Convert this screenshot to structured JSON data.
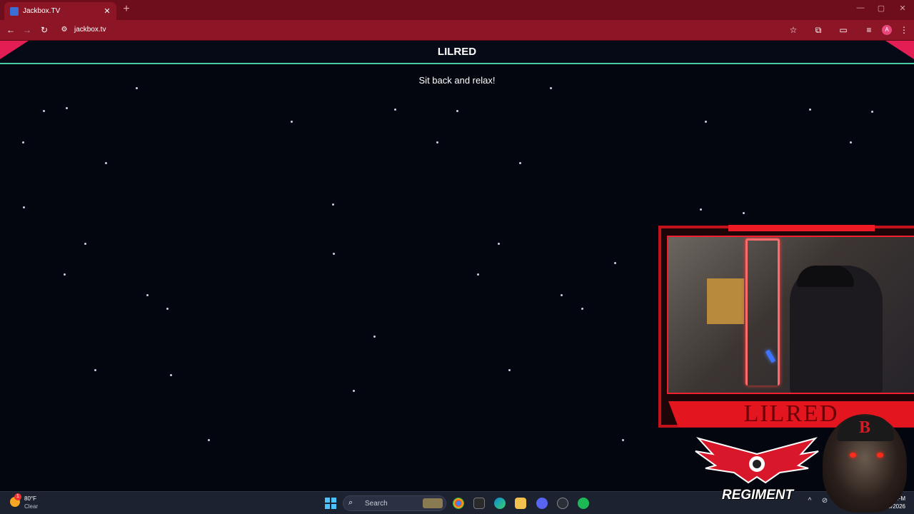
{
  "browser": {
    "tab_title": "Jackbox.TV",
    "tab_close_icon": "✕",
    "new_tab_icon": "+",
    "url": "jackbox.tv",
    "profile_initial": "A"
  },
  "game": {
    "player_name": "LILRED",
    "status_message": "Sit back and relax!"
  },
  "overlay": {
    "nameplate": "LILRED",
    "emblem_text": "REGIMENT",
    "skull_letter": "B"
  },
  "taskbar": {
    "weather_temp": "80°F",
    "weather_desc": "Clear",
    "weather_badge": "1",
    "search_placeholder": "Search",
    "clock_time": "FM",
    "clock_date": "28/2026"
  },
  "colors": {
    "tabstrip": "#6e0d1b",
    "toolbar": "#8d1626",
    "page_bg": "#03050f",
    "banner_accent": "#e21e54",
    "banner_line": "#49c9a4",
    "overlay_red": "#e3151f"
  }
}
